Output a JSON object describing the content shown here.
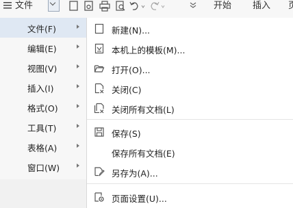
{
  "toolbar": {
    "hamburger_icon": "hamburger-icon",
    "file_label": "文件",
    "tab_start": "开始",
    "tab_insert": "插入",
    "tab_more": "页"
  },
  "menu": {
    "items": [
      {
        "label": "文件(F)",
        "active": true
      },
      {
        "label": "编辑(E)"
      },
      {
        "label": "视图(V)"
      },
      {
        "label": "插入(I)"
      },
      {
        "label": "格式(O)"
      },
      {
        "label": "工具(T)"
      },
      {
        "label": "表格(A)"
      },
      {
        "label": "窗口(W)"
      }
    ]
  },
  "submenu": {
    "items": [
      {
        "label": "新建(N)...",
        "icon": "new-doc-icon"
      },
      {
        "label": "本机上的模板(M)...",
        "icon": "template-icon"
      },
      {
        "label": "打开(O)...",
        "icon": "folder-open-icon"
      },
      {
        "label": "关闭(C)",
        "icon": "close-doc-icon"
      },
      {
        "label": "关闭所有文档(L)",
        "icon": "close-all-docs-icon"
      },
      {
        "label": "保存(S)",
        "icon": "save-icon"
      },
      {
        "label": "保存所有文档(E)",
        "icon": ""
      },
      {
        "label": "另存为(A)...",
        "icon": "save-as-icon"
      },
      {
        "label": "页面设置(U)...",
        "icon": "page-setup-icon"
      }
    ]
  }
}
